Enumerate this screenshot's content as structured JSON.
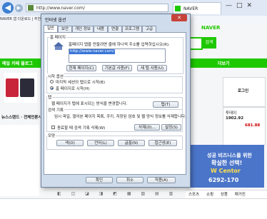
{
  "browser": {
    "address": "http://www.naver.com/",
    "tab_title": "NAVER",
    "favorites": "NAVER 앱 다운로드   |   추천 사이트 ▾   |   웹 조각 갤러리 ▾",
    "window_controls": "—□✕"
  },
  "naver": {
    "logo": "NAVER",
    "search_button": "검색",
    "nav_left": "메일  카페  블로그",
    "nav_right": "더보기",
    "login_label": "로그인",
    "news_label": "뉴스스탠드  · 전체언론사",
    "weather_date": "투데이",
    "stock_kospi": "1902.92",
    "stock_kosdaq": "681.88",
    "ad_line1": "성공 비즈니스를 위한",
    "ad_line2": "확실한 선택!",
    "ad_line3": "W Centor",
    "ad_line4": "6292-170",
    "bottom_tabs": [
      "스포츠",
      "쇼핑",
      "상품",
      "매거진"
    ],
    "bottom_icons": "◧ ◫ ◪ ◨ ◩ ▦ ▧ ▤ ▥"
  },
  "dialog": {
    "title": "인터넷 옵션",
    "close": "✕",
    "tabs": [
      "일반",
      "보안",
      "개인 정보",
      "내용",
      "연결",
      "프로그램",
      "고급"
    ],
    "home": {
      "group": "홈 페이지",
      "desc": "홈페이지 탭을 만들려면 줄에 하나씩 주소를 입력하십시오(R).",
      "url": "http://www.naver.com/",
      "btn_current": "현재 페이지(C)",
      "btn_default": "기본값 사용(F)",
      "btn_new_tab": "새 탭 사용(U)"
    },
    "startup": {
      "group": "시작 옵션",
      "opt1": "마지막 세션의 탭으로 시작(B)",
      "opt2": "홈 페이지로 시작(H)"
    },
    "tabs_group": {
      "group": "탭",
      "desc": "웹 페이지가 탭에 표시되는 방식을 변경합니다.",
      "btn": "탭(T)"
    },
    "history": {
      "group": "검색 기록",
      "desc": "임시 파일, 열어본 페이지 목록, 쿠키, 저장된 암호 및 웹 양식 정보를 삭제합니다.",
      "checkbox": "종료할 때 검색 기록 삭제(W)",
      "btn_delete": "삭제(D)...",
      "btn_settings": "설정(S)"
    },
    "appearance": {
      "group": "모양",
      "btn_colors": "색(O)",
      "btn_languages": "언어(L)",
      "btn_fonts": "글꼴(N)",
      "btn_accessibility": "접근성(E)"
    },
    "footer": {
      "ok": "확인",
      "cancel": "취소",
      "apply": "적용(A)"
    }
  }
}
